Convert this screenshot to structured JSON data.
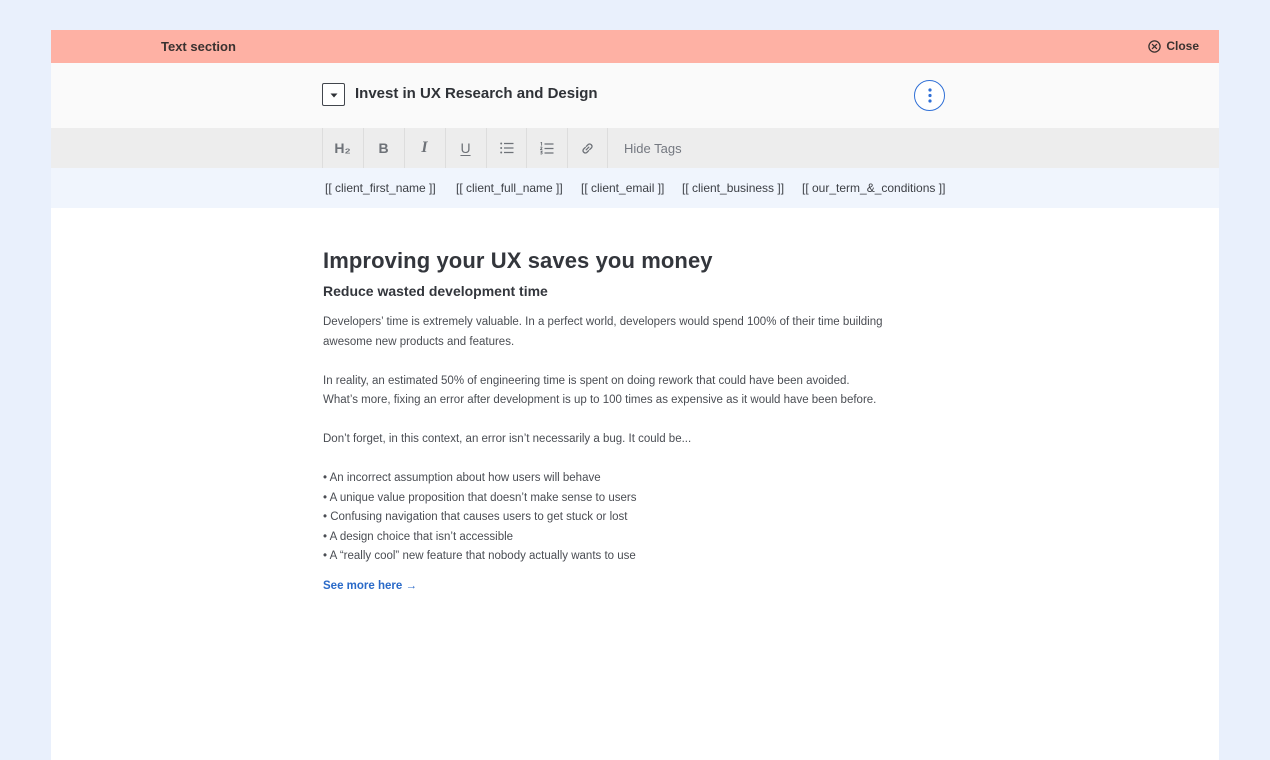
{
  "topbar": {
    "title": "Text section",
    "close_label": "Close"
  },
  "section": {
    "title": "Invest in UX Research and Design"
  },
  "toolbar": {
    "heading_label": "H₂",
    "bold_label": "B",
    "italic_label": "I",
    "underline_label": "U",
    "hide_tags_label": "Hide Tags"
  },
  "tags": [
    "[[ client_first_name ]]",
    "[[ client_full_name ]]",
    "[[ client_email ]]",
    "[[ client_business ]]",
    "[[ our_term_&_conditions ]]"
  ],
  "content": {
    "heading": "Improving your UX saves you money",
    "subheading": "Reduce wasted development time",
    "paragraph1": "Developers’ time is extremely valuable. In a perfect world, developers would spend 100% of their time building awesome new products and features.",
    "paragraph2": "In reality, an estimated 50% of engineering time is spent on doing rework that could have been avoided. What’s more, fixing an error after development is up to 100 times as expensive as it would have been before.",
    "paragraph3": "Don’t forget, in this context, an error isn’t necessarily a bug. It could be...",
    "bullets": [
      "• An incorrect assumption about how users will behave",
      "• A unique value proposition that doesn’t make sense to users",
      "• Confusing navigation that causes users to get stuck or lost",
      "• A design choice that isn’t accessible",
      "• A “really cool” new feature that nobody actually wants to use"
    ],
    "see_more": "See more here →"
  },
  "colors": {
    "page_background": "#e9f0fc",
    "topbar": "#feb1a4",
    "toolbar": "#ededed",
    "tags_row": "#f0f5fd",
    "link": "#2a6ac8",
    "more_button_border": "#2f6fd6"
  },
  "icons": {
    "close": "close-circle-icon",
    "collapse": "caret-down-icon",
    "more": "vertical-dots-icon",
    "bullet_list": "bullet-list-icon",
    "numbered_list": "numbered-list-icon",
    "link": "link-icon"
  }
}
